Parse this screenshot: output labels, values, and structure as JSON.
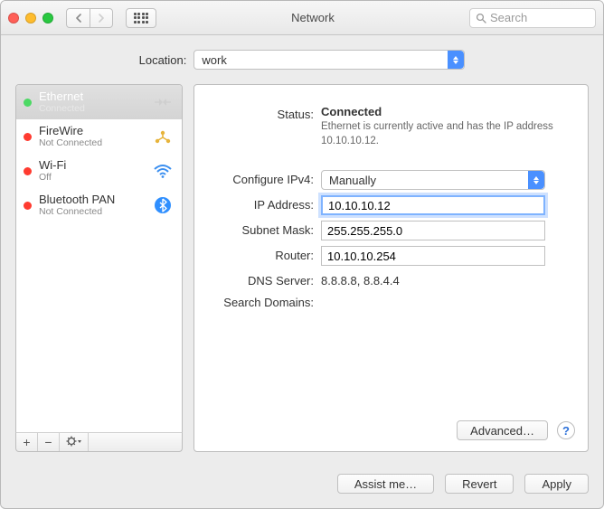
{
  "window": {
    "title": "Network"
  },
  "toolbar": {
    "search_placeholder": "Search"
  },
  "location": {
    "label": "Location:",
    "value": "work"
  },
  "services": [
    {
      "name": "Ethernet",
      "status": "Connected",
      "dot": "green",
      "icon": "ethernet",
      "selected": true
    },
    {
      "name": "FireWire",
      "status": "Not Connected",
      "dot": "red",
      "icon": "firewire",
      "selected": false
    },
    {
      "name": "Wi-Fi",
      "status": "Off",
      "dot": "red",
      "icon": "wifi",
      "selected": false
    },
    {
      "name": "Bluetooth PAN",
      "status": "Not Connected",
      "dot": "red",
      "icon": "bluetooth",
      "selected": false
    }
  ],
  "detail": {
    "status_label": "Status:",
    "status_value": "Connected",
    "status_hint": "Ethernet is currently active and has the IP address 10.10.10.12.",
    "configure_label": "Configure IPv4:",
    "configure_value": "Manually",
    "ip_label": "IP Address:",
    "ip_value": "10.10.10.12",
    "subnet_label": "Subnet Mask:",
    "subnet_value": "255.255.255.0",
    "router_label": "Router:",
    "router_value": "10.10.10.254",
    "dns_label": "DNS Server:",
    "dns_value": "8.8.8.8, 8.8.4.4",
    "search_label": "Search Domains:",
    "search_value": "",
    "advanced_label": "Advanced…"
  },
  "footer": {
    "assist": "Assist me…",
    "revert": "Revert",
    "apply": "Apply"
  }
}
